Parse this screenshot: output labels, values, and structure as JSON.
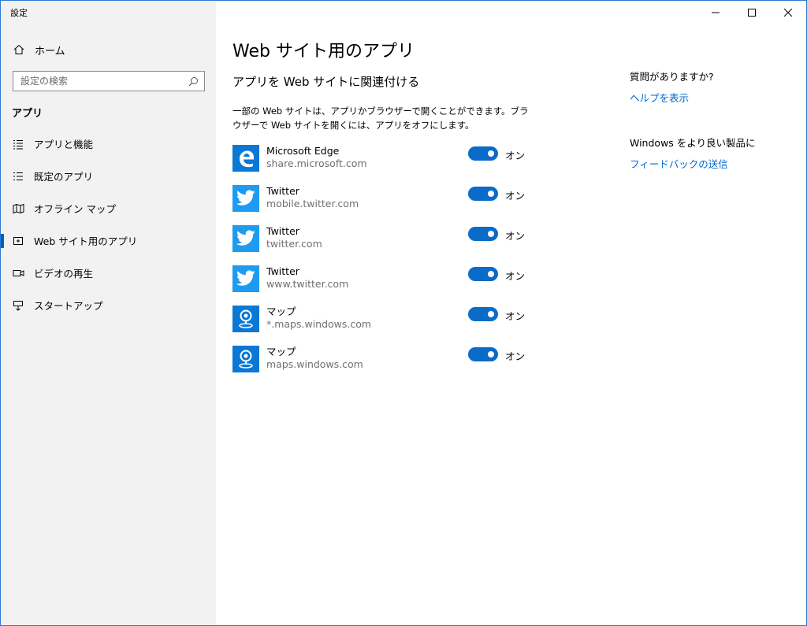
{
  "window": {
    "title": "設定"
  },
  "colors": {
    "accent": "#0a6bc9",
    "sidebar_bg": "#f2f2f2",
    "link": "#0066cc"
  },
  "sidebar": {
    "home_label": "ホーム",
    "home_icon": "home-icon",
    "search_placeholder": "設定の検索",
    "section": "アプリ",
    "items": [
      {
        "label": "アプリと機能",
        "icon": "list-icon"
      },
      {
        "label": "既定のアプリ",
        "icon": "list-check-icon"
      },
      {
        "label": "オフライン マップ",
        "icon": "map-icon"
      },
      {
        "label": "Web サイト用のアプリ",
        "icon": "web-apps-icon"
      },
      {
        "label": "ビデオの再生",
        "icon": "video-icon"
      },
      {
        "label": "スタートアップ",
        "icon": "startup-icon"
      }
    ],
    "active_index": 3
  },
  "main": {
    "title": "Web サイト用のアプリ",
    "subtitle": "アプリを Web サイトに関連付ける",
    "description": "一部の Web サイトは、アプリかブラウザーで開くことができます。ブラウザーで Web サイトを開くには、アプリをオフにします。",
    "apps": [
      {
        "name": "Microsoft Edge",
        "url": "share.microsoft.com",
        "icon": "edge-icon",
        "toggle": "オン",
        "on": true
      },
      {
        "name": "Twitter",
        "url": "mobile.twitter.com",
        "icon": "twitter-icon",
        "toggle": "オン",
        "on": true
      },
      {
        "name": "Twitter",
        "url": "twitter.com",
        "icon": "twitter-icon",
        "toggle": "オン",
        "on": true
      },
      {
        "name": "Twitter",
        "url": "www.twitter.com",
        "icon": "twitter-icon",
        "toggle": "オン",
        "on": true
      },
      {
        "name": "マップ",
        "url": "*.maps.windows.com",
        "icon": "maps-icon",
        "toggle": "オン",
        "on": true
      },
      {
        "name": "マップ",
        "url": "maps.windows.com",
        "icon": "maps-icon",
        "toggle": "オン",
        "on": true
      }
    ]
  },
  "right_panel": {
    "question": "質問がありますか?",
    "help_link": "ヘルプを表示",
    "feedback_prompt": "Windows をより良い製品に",
    "feedback_link": "フィードバックの送信"
  }
}
